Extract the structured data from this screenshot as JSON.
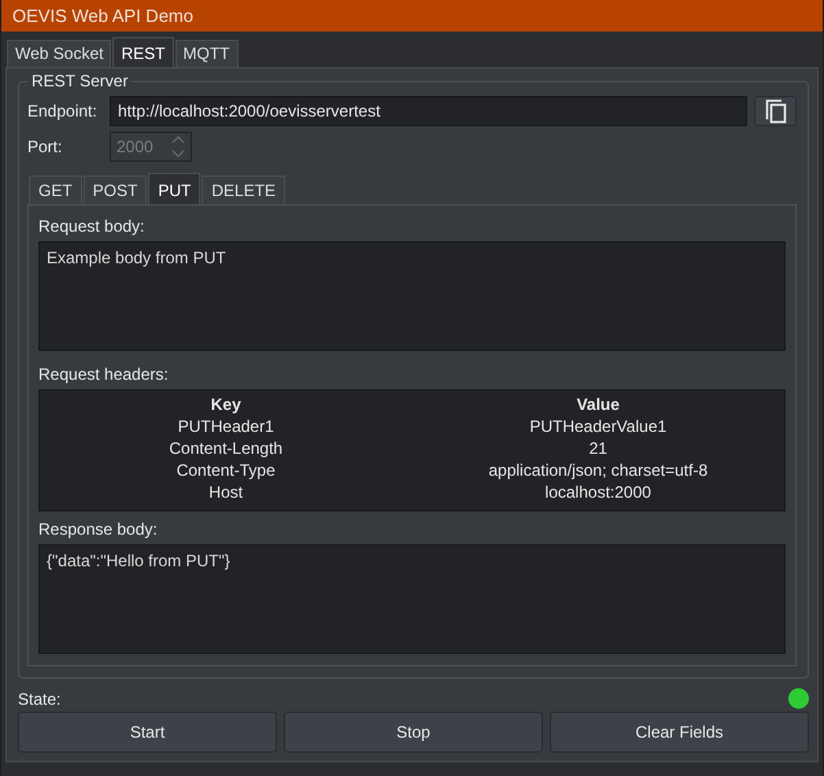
{
  "window": {
    "title": "OEVIS Web API Demo"
  },
  "tabs": [
    {
      "label": "Web Socket",
      "selected": false
    },
    {
      "label": "REST",
      "selected": true
    },
    {
      "label": "MQTT",
      "selected": false
    }
  ],
  "group": {
    "title": "REST Server"
  },
  "endpoint": {
    "label": "Endpoint:",
    "value": "http://localhost:2000/oevisservertest"
  },
  "port": {
    "label": "Port:",
    "value": "2000",
    "disabled": true
  },
  "method_tabs": [
    {
      "label": "GET",
      "selected": false
    },
    {
      "label": "POST",
      "selected": false
    },
    {
      "label": "PUT",
      "selected": true
    },
    {
      "label": "DELETE",
      "selected": false
    }
  ],
  "request_body": {
    "label": "Request body:",
    "value": "Example body from PUT"
  },
  "request_headers": {
    "label": "Request headers:",
    "columns": [
      "Key",
      "Value"
    ],
    "rows": [
      [
        "PUTHeader1",
        "PUTHeaderValue1"
      ],
      [
        "Content-Length",
        "21"
      ],
      [
        "Content-Type",
        "application/json; charset=utf-8"
      ],
      [
        "Host",
        "localhost:2000"
      ]
    ]
  },
  "response_body": {
    "label": "Response body:",
    "value": "{\"data\":\"Hello from PUT\"}"
  },
  "state": {
    "label": "State:",
    "running": true
  },
  "buttons": [
    "Start",
    "Stop",
    "Clear Fields"
  ]
}
